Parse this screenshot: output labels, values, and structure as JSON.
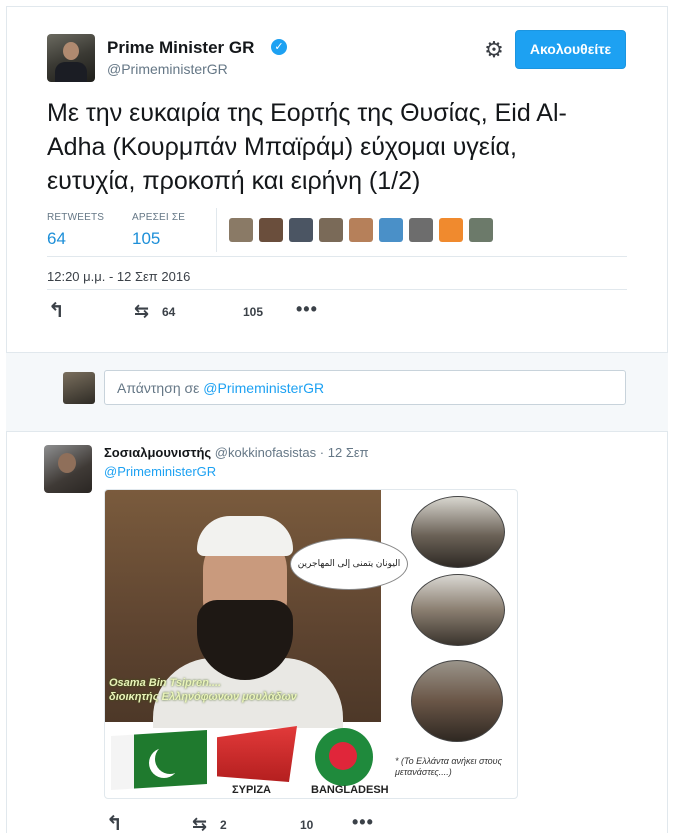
{
  "main_tweet": {
    "name": "Prime Minister GR",
    "handle": "@PrimeministerGR",
    "follow_label": "Ακολουθείτε",
    "text": "Με την ευκαιρία της Εορτής της Θυσίας, Eid Al-Adha (Κουρμπάν Μπαϊράμ) εύχομαι υγεία, ευτυχία, προκοπή και ειρήνη (1/2)",
    "retweets_label": "RETWEETS",
    "retweets_value": "64",
    "likes_label": "ΑΡΕΣΕΙ ΣΕ",
    "likes_value": "105",
    "timestamp": "12:20 μ.μ. - 12 Σεπ 2016",
    "action_retweet_count": "64",
    "action_like_count": "105",
    "liker_colors": [
      "#8a7a66",
      "#6a4e3c",
      "#4b5563",
      "#7a6a58",
      "#b6805a",
      "#4a90c8",
      "#6d6d6d",
      "#f08a2e",
      "#6c7a6a"
    ]
  },
  "reply_box": {
    "prefix": "Απάντηση σε ",
    "mention": "@PrimeministerGR"
  },
  "reply_tweet": {
    "name": "Σοσιαλμουνιστής",
    "handle": "@kokkinofasistas",
    "date": "12 Σεπ",
    "mention": "@PrimeministerGR",
    "action_retweet_count": "2",
    "action_like_count": "10",
    "image": {
      "caption_line1": "Osama Bin Tsipren....",
      "caption_line2": "διοικητής Ελληνόφωνων μουλάδων",
      "bubble_text": "اليونان يتمنى إلى المهاجرين",
      "syriza_label": "ΣΥΡΙΖΑ",
      "bangladesh_label": "BANGLADESH",
      "note": "* (Το Ελλάντα ανήκει στους μετανάστες....)"
    }
  },
  "colors": {
    "accent": "#1da1f2",
    "text_secondary": "#657786",
    "stat_value": "#1d8fd8"
  }
}
